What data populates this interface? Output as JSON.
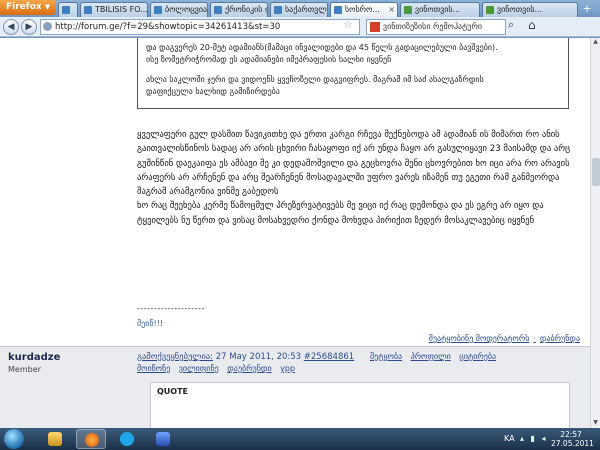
{
  "browser": {
    "app_button": "Firefox",
    "tabs": [
      {
        "label": "",
        "active": false
      },
      {
        "label": "TBILISIS FO...",
        "active": false
      },
      {
        "label": "ბოლოცვია...",
        "active": false
      },
      {
        "label": "ქრონიკის ფ...",
        "active": false
      },
      {
        "label": "საქართვლ...",
        "active": false
      },
      {
        "label": "სოსრო...",
        "active": true
      },
      {
        "label": "ვინოთვის...",
        "active": false
      },
      {
        "label": "ვინოთვის...",
        "active": false
      }
    ],
    "new_tab_label": "+",
    "url": "http://forum.ge/?f=29&showtopic=34261413&st=30",
    "search_placeholder": "ვინთიზეზისი რემოჰატური"
  },
  "quote": {
    "line1": "და დაგვერეს 20-მეტ ადამიანს(მამაცი ინვალიდები და 45 წელს გადაცილებული ბავშვები).",
    "line2": "ისე ზომეტრიჭრომად ეს ადამიანები იმეპრაფესის ხალხი იყვნენ",
    "line3": "ახლა საკლოში ჯერი და ვიდოენს ყვეჩოზელი დაგვიფრეს. მაგრამ იმ საძ ახალგაზრდის",
    "line4": "დაფიქცულა ხალხიდ გამიზირდება"
  },
  "post": {
    "paragraph1": "ყველაფერი გულ დასმით წავიკითხე და ერთი კარგი რჩევა მექნებოდა ამ ადამიან ის მიმართ რო ანის გაითვალისწინოს სადაც არ არის ცხვირი ჩასაყოფი იქ არ უნდა ჩაყო არ გასულიყავი 23 მაისამდ და არც გუშინწინ დაეკაიფა ეს ამბავი მე კი დედამოშვილი და გეცხოვრა შენი ცხოვრებით ხო იცი არა რო არავის არაფერს არ არჩენენ და არც შეარჩენენ მოსადავალში უფრო ვარეს იზამენ თუ ეგეთი რამ განმეორდა მაგრამ არამგონია ვინმე გაბედოს",
    "paragraph2": "ხო რაც შეეხება კერმე წამოცმულ პრეზერვატივებს მე ვიცი იქ რაც დემონდა და ეს ეგრე არ იყო და ტყვილებს ნუ წერთ და ვისაც მოსახვედრი ქონდა მოხვდა პირიქით ზედერ მოსაკლავებიც იყვნენ",
    "signature_divider": "--------------------",
    "signature_text": "მეიწ!!!",
    "links": [
      "შეატყობინე მოდერატორს",
      "დაბრუნდა"
    ]
  },
  "post2": {
    "username": "kurdadze",
    "role": "Member",
    "date_link": "გამოქვეყნებულია:",
    "date": "27 May 2011, 20:53",
    "post_number": "#25684861",
    "actions_row1": [
      "შეტყობა",
      "პროფილი",
      "ციტირება"
    ],
    "actions_row2": [
      "მოიწონე",
      "ვილიფინე",
      "დაუბრუნდი",
      "ypp"
    ],
    "quote_label": "QUOTE"
  },
  "taskbar": {
    "language": "KA",
    "time": "22:57",
    "date": "27.05.2011"
  },
  "colors": {
    "link": "#2a4c8c",
    "tab_strip": "#7aa1cc",
    "taskbar": "#1c3049"
  }
}
